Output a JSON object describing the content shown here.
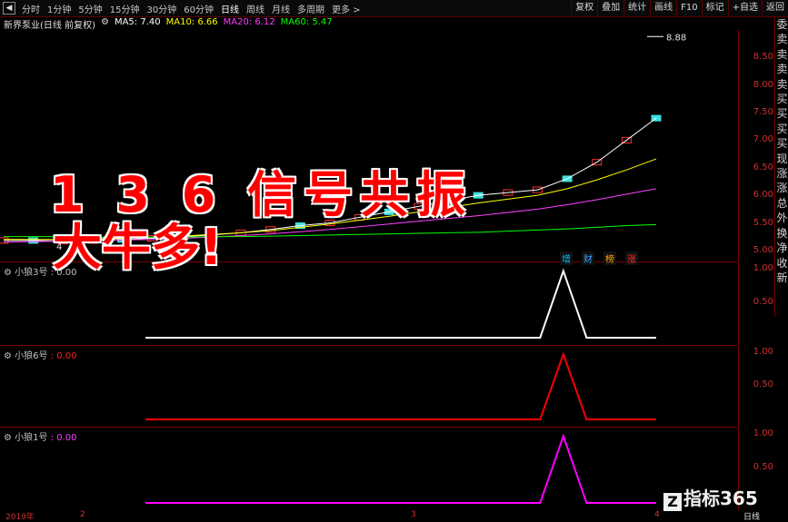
{
  "toolbar": {
    "left_icon": "◀",
    "periods": [
      "分时",
      "1分钟",
      "5分钟",
      "15分钟",
      "30分钟",
      "60分钟",
      "日线",
      "周线",
      "月线",
      "多周期",
      "更多 >"
    ],
    "active_period": "日线",
    "right_tools": [
      "复权",
      "叠加",
      "统计",
      "画线",
      "F10",
      "标记",
      "+自选",
      "返回"
    ]
  },
  "info": {
    "stock_name": "新界泵业(日线 前复权)",
    "ma5": "MA5: 7.40",
    "ma10": "MA10: 6.66",
    "ma20": "MA20: 6.12",
    "ma60": "MA60: 5.47"
  },
  "colors": {
    "ma5": "#ffffff",
    "ma10": "#ffff00",
    "ma20": "#ff40ff",
    "ma60": "#00ff00",
    "axis": "#d03030",
    "border": "#7a0000",
    "overlay_text": "#ff0000"
  },
  "main_axis": [
    "8.50",
    "8.00",
    "7.50",
    "7.00",
    "6.50",
    "6.00",
    "5.50",
    "5.00"
  ],
  "high_label": "8.88",
  "low_label": "4",
  "overlay": {
    "line1": "1 3 6 信号共振",
    "line2": "大牛多!"
  },
  "tags": [
    {
      "text": "增",
      "color": "#00c0ff"
    },
    {
      "text": "财",
      "color": "#40a0ff"
    },
    {
      "text": "榜",
      "color": "#ffa000"
    },
    {
      "text": "涨",
      "color": "#ff3030"
    }
  ],
  "panels": [
    {
      "name": "小狼3号",
      "value": ": 0.00",
      "value_color": "#c0c0c0",
      "color": "#ffffff",
      "ticks": [
        "1.00",
        "0.50"
      ]
    },
    {
      "name": "小狼6号",
      "value": ": 0.00",
      "value_color": "#ff2020",
      "color": "#ff0000",
      "ticks": [
        "1.00",
        "0.50"
      ]
    },
    {
      "name": "小狼1号",
      "value": ": 0.00",
      "value_color": "#ff40ff",
      "color": "#ff00ff",
      "ticks": [
        "1.00",
        "0.50"
      ]
    }
  ],
  "right_strip": [
    "委",
    "卖",
    "卖",
    "卖",
    "卖",
    "买",
    "买",
    "买",
    "买",
    "现",
    "涨",
    "涨",
    "总",
    "外",
    "换",
    "净",
    "收",
    "新"
  ],
  "bottom": {
    "year": "2019年",
    "m1": "2",
    "m2": "3",
    "m3": "4",
    "day_label": "日线"
  },
  "watermark": {
    "logo": "Z",
    "text": "指标365"
  },
  "chart_data": [
    {
      "type": "line",
      "title": "",
      "ylim": [
        4.8,
        9.0
      ],
      "series": [
        {
          "name": "MA5",
          "values": [
            5.18,
            5.18,
            5.17,
            5.18,
            5.2,
            5.22,
            5.25,
            5.28,
            5.32,
            5.38,
            5.45,
            5.5,
            5.6,
            5.7,
            5.8,
            5.9,
            6.0,
            6.05,
            6.1,
            6.3,
            6.6,
            7.0,
            7.4
          ]
        },
        {
          "name": "MA10",
          "values": [
            5.2,
            5.2,
            5.2,
            5.21,
            5.22,
            5.24,
            5.26,
            5.29,
            5.32,
            5.36,
            5.42,
            5.48,
            5.55,
            5.62,
            5.7,
            5.78,
            5.86,
            5.93,
            6.0,
            6.12,
            6.28,
            6.46,
            6.66
          ]
        },
        {
          "name": "MA20",
          "values": [
            5.15,
            5.16,
            5.17,
            5.18,
            5.19,
            5.2,
            5.22,
            5.24,
            5.27,
            5.3,
            5.34,
            5.38,
            5.43,
            5.48,
            5.53,
            5.58,
            5.63,
            5.69,
            5.75,
            5.83,
            5.92,
            6.02,
            6.12
          ]
        },
        {
          "name": "MA60",
          "values": [
            5.25,
            5.25,
            5.25,
            5.24,
            5.24,
            5.24,
            5.24,
            5.25,
            5.25,
            5.26,
            5.27,
            5.28,
            5.29,
            5.3,
            5.31,
            5.32,
            5.33,
            5.35,
            5.37,
            5.39,
            5.42,
            5.45,
            5.47
          ]
        }
      ]
    },
    {
      "type": "line",
      "series": [
        {
          "name": "小狼3号",
          "values": [
            0,
            0,
            0,
            0,
            0,
            0,
            0,
            0,
            0,
            0,
            0,
            0,
            0,
            0,
            0,
            0,
            0,
            0,
            1,
            0,
            0,
            0,
            0
          ]
        }
      ],
      "ylim": [
        0,
        1.1
      ]
    },
    {
      "type": "line",
      "series": [
        {
          "name": "小狼6号",
          "values": [
            0,
            0,
            0,
            0,
            0,
            0,
            0,
            0,
            0,
            0,
            0,
            0,
            0,
            0,
            0,
            0,
            0,
            0,
            1,
            0,
            0,
            0,
            0
          ]
        }
      ],
      "ylim": [
        0,
        1.1
      ]
    },
    {
      "type": "line",
      "series": [
        {
          "name": "小狼1号",
          "values": [
            0,
            0,
            0,
            0,
            0,
            0,
            0,
            0,
            0,
            0,
            0,
            0,
            0,
            0,
            0,
            0,
            0,
            0,
            1,
            0,
            0,
            0,
            0
          ]
        }
      ],
      "ylim": [
        0,
        1.1
      ]
    }
  ]
}
